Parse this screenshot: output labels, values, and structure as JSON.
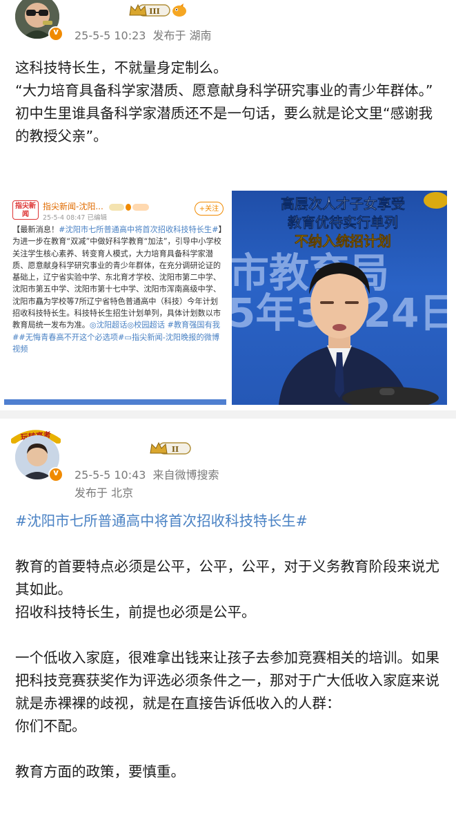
{
  "post1": {
    "timestamp": "25-5-5 10:23",
    "location": "发布于 湖南",
    "level_badge": "III",
    "paragraphs": [
      "这科技特长生，不就量身定制么。",
      "“大力培育具备科学家潜质、愿意献身科学研究事业的青少年群体。”",
      "初中生里谁具备科学家潜质还不是一句话，要么就是论文里“感谢我的教授父亲”。"
    ],
    "embedded_left": {
      "logo": "指尖新闻",
      "source_name": "指尖新闻-沈阳...",
      "time": "25-5-4 08:47",
      "edited": "已编辑",
      "follow_label": "+关注",
      "text_prefix": "【最新消息！",
      "text_tag": "#沈阳市七所普通高中将首次招收科技特长生#",
      "text_body": "】为进一步在教育“双减”中做好科学教育“加法”，引导中小学校关注学生核心素养、转变育人模式，大力培育具备科学家潜质、愿意献身科学研究事业的青少年群体，在充分调研论证的基础上，辽宁省实验中学、东北育才学校、沈阳市第二中学、沈阳市第五中学、沈阳市第十七中学、沈阳市浑南高级中学、沈阳市矗为学校等7所辽宁省特色普通高中（科技）今年计划招收科技特长生。科技特长生招生计划单列，具体计划数以市教育局统一发布为准。",
      "links": [
        "◎沈阳超话",
        "◎校园超话",
        "#教育强国有我#",
        "#无悔青春高不开这个必选项#",
        "▭指尖新闻-沈阳晚报的微博视频"
      ]
    },
    "embedded_right": {
      "bg_text_1": "市教育局",
      "bg_text_2": "5年3月24日",
      "caption_line1": "高层次人才子女享受",
      "caption_line2": "教育优待实行单列",
      "caption_line3": "不纳入统招计划"
    }
  },
  "post2": {
    "avatar_tag": "玩转高考",
    "level_badge": "II",
    "timestamp": "25-5-5 10:43",
    "source": "来自微博搜索",
    "location": "发布于 北京",
    "hashtag": "#沈阳市七所普通高中将首次招收科技特长生#",
    "paragraphs": [
      "教育的首要特点必须是公平，公平，公平，对于义务教育阶段来说尤其如此。",
      "招收科技特长生，前提也必须是公平。",
      "",
      "一个低收入家庭，很难拿出钱来让孩子去参加竞赛相关的培训。如果把科技竞赛获奖作为评选必须条件之一，那对于广大低收入家庭来说就是赤裸裸的歧视，就是在直接告诉低收入的人群：",
      "你们不配。",
      "",
      "教育方面的政策，要慎重。"
    ]
  }
}
